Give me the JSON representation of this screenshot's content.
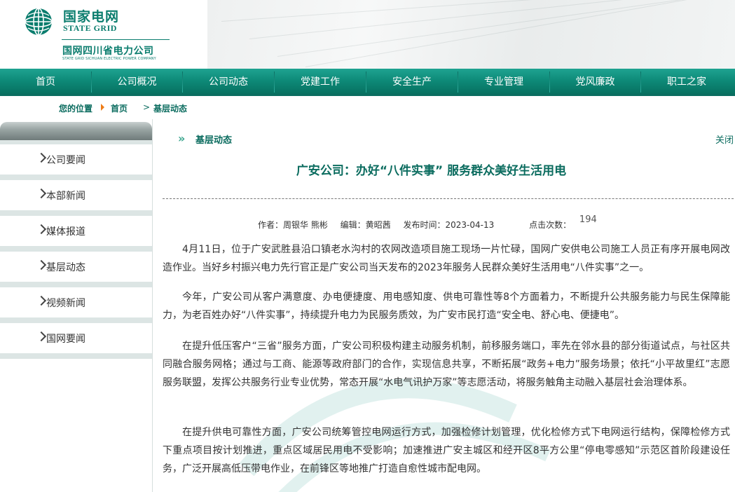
{
  "header": {
    "brand_cn": "国家电网",
    "brand_en": "STATE GRID",
    "company_cn": "国网四川省电力公司",
    "company_en": "STATE GRID SICHUAN ELECTRIC POWER COMPANY",
    "brand_color": "#0b7d6e"
  },
  "nav": {
    "items": [
      "首页",
      "公司概况",
      "公司动态",
      "党建工作",
      "安全生产",
      "专业管理",
      "党风廉政",
      "职工之家"
    ],
    "color": "#0e8b79"
  },
  "breadcrumb": {
    "label": "您的位置",
    "home": "首页",
    "current": "基层动态"
  },
  "sidebar": {
    "items": [
      "公司要闻",
      "本部新闻",
      "媒体报道",
      "基层动态",
      "视频新闻",
      "国网要闻"
    ]
  },
  "content": {
    "section_title": "基层动态",
    "close": "关闭",
    "title": "广安公司：办好“八件实事” 服务群众美好生活用电",
    "meta": {
      "author": "作者：周银华 熊彬",
      "editor": "编辑：黄昭茜",
      "date": "发布时间：2023-04-13",
      "clicks_label": "点击次数：",
      "clicks": "194"
    },
    "paragraphs": [
      "4月11日，位于广安武胜县沿口镇老水沟村的农网改造项目施工现场一片忙碌，国网广安供电公司施工人员正有序开展电网改造作业。当好乡村振兴电力先行官正是广安公司当天发布的2023年服务人民群众美好生活用电“八件实事”之一。",
      "今年，广安公司从客户满意度、办电便捷度、用电感知度、供电可靠性等8个方面着力，不断提升公共服务能力与民生保障能力，为老百姓办好“八件实事”，持续提升电力为民服务质效，为广安市民打造“安全电、舒心电、便捷电”。",
      "在提升低压客户“三省”服务方面，广安公司积极构建主动服务机制，前移服务端口，率先在邻水县的部分街道试点，与社区共同融合服务网格；通过与工商、能源等政府部门的合作，实现信息共享，不断拓展“政务+电力”服务场景；依托“小平故里红”志愿服务联盟，发挥公共服务行业专业优势，常态开展“水电气讯护万家”等志愿活动，将服务触角主动融入基层社会治理体系。",
      "在提升供电可靠性方面，广安公司统筹管控电网运行方式，加强检修计划管理，优化检修方式下电网运行结构，保障检修方式下重点项目按计划推进，重点区域居民用电不受影响；加速推进广安主城区和经开区8平方公里“停电零感知”示范区首阶段建设任务，广泛开展高低压带电作业，在前锋区等地推广打造自愈性城市配电网。"
    ]
  }
}
